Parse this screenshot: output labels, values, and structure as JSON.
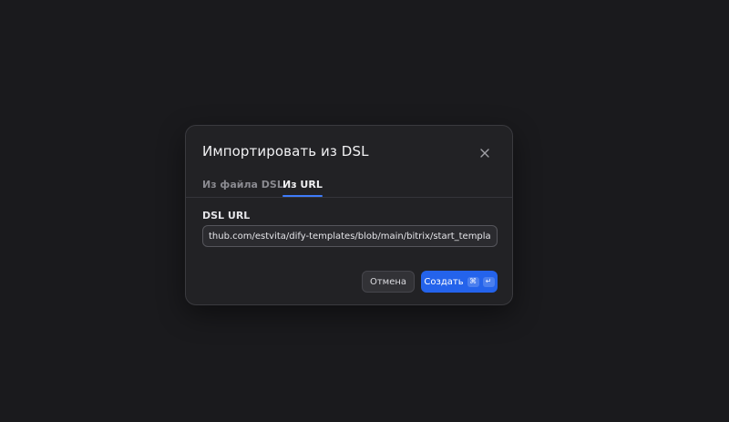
{
  "dialog": {
    "title": "Импортировать из DSL",
    "tabs": [
      {
        "label": "Из файла DSL",
        "active": false
      },
      {
        "label": "Из URL",
        "active": true
      }
    ],
    "field_label": "DSL URL",
    "url_value": "thub.com/estvita/dify-templates/blob/main/bitrix/start_template.yml",
    "cancel_label": "Отмена",
    "create_label": "Создать",
    "create_shortcut": [
      "⌘",
      "↵"
    ],
    "close_icon": "close-icon"
  },
  "colors": {
    "accent": "#2463eb",
    "tab_underline": "#3e7bfa",
    "background": "#1a1a1d",
    "dialog_bg": "#222225"
  }
}
